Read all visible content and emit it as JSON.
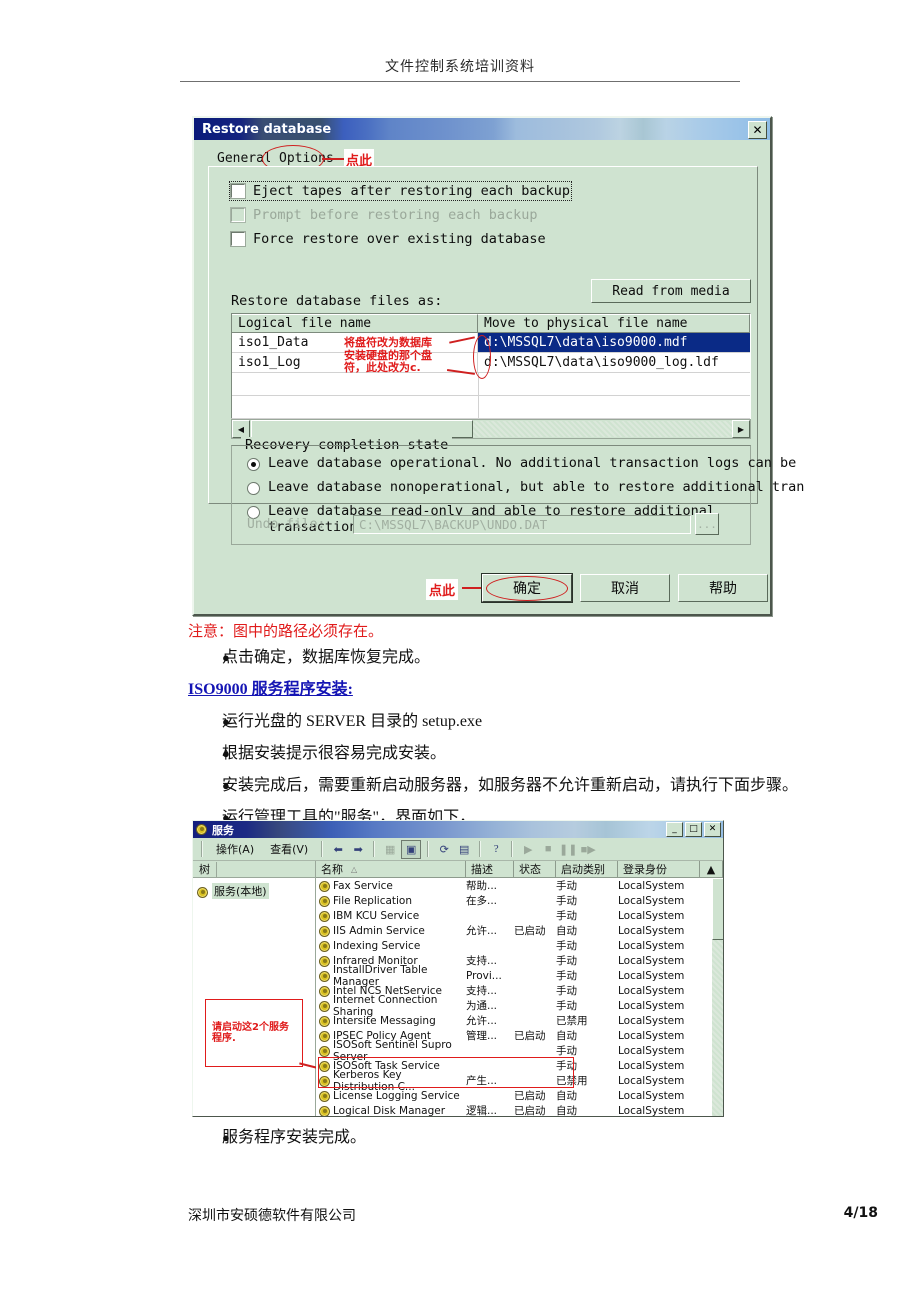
{
  "document": {
    "header_title": "文件控制系统培训资料",
    "footer_company": "深圳市安硕德软件有限公司",
    "footer_page": "4/18"
  },
  "restore_dialog": {
    "title": "Restore database",
    "close_glyph": "✕",
    "tabs": [
      {
        "label": "General"
      },
      {
        "label": "Options"
      }
    ],
    "checkboxes": [
      {
        "label": "Eject tapes after restoring each backup",
        "checked": false,
        "disabled": false,
        "focused": true
      },
      {
        "label": "Prompt before restoring each backup",
        "checked": false,
        "disabled": true,
        "focused": false
      },
      {
        "label": "Force restore over existing database",
        "checked": false,
        "disabled": false,
        "focused": false
      }
    ],
    "restore_files_label": "Restore database files as:",
    "read_from_media_label": "Read from media",
    "grid": {
      "columns": [
        "Logical file name",
        "Move to physical file name"
      ],
      "rows": [
        {
          "logical": "iso1_Data",
          "physical": "d:\\MSSQL7\\data\\iso9000.mdf",
          "selected": true
        },
        {
          "logical": "iso1_Log",
          "physical": "d:\\MSSQL7\\data\\iso9000_log.ldf",
          "selected": false
        }
      ]
    },
    "recovery_group_label": "Recovery completion state",
    "recovery_options": [
      {
        "label": "Leave database operational. No additional transaction logs can be",
        "selected": true
      },
      {
        "label": "Leave database nonoperational, but able to restore additional tran",
        "selected": false
      },
      {
        "label": "Leave database read-only and able to restore additional",
        "label2": "transaction logs.",
        "selected": false
      }
    ],
    "undo_file_label": "Undo file:",
    "undo_file_value": "C:\\MSSQL7\\BACKUP\\UNDO.DAT",
    "undo_browse_label": "...",
    "buttons": [
      {
        "label": "确定",
        "name": "ok"
      },
      {
        "label": "取消",
        "name": "cancel"
      },
      {
        "label": "帮助",
        "name": "help"
      }
    ],
    "annotations": {
      "click_here_tab": "点此",
      "click_here_ok": "点此",
      "drive_note_line1": "将盘符改为数据库",
      "drive_note_line2": "安装硬盘的那个盘",
      "drive_note_line3": "符，此处改为c."
    }
  },
  "body_text": {
    "note": "注意：图中的路径必须存在。",
    "bullets_before": [
      "点击确定，数据库恢复完成。"
    ],
    "section_heading": "ISO9000 服务程序安装:",
    "bullets_after": [
      "运行光盘的 SERVER 目录的 setup.exe",
      "根据安装提示很容易完成安装。",
      "安装完成后，需要重新启动服务器，如服务器不允许重新启动，请执行下面步骤。",
      "运行管理工具的\"服务\"，界面如下，"
    ],
    "bullet_last": "服务程序安装完成。",
    "bullet_glyph": "●"
  },
  "services_window": {
    "title": "服务",
    "window_buttons": [
      "_",
      "□",
      "✕"
    ],
    "menus": [
      "操作(A)",
      "查看(V)"
    ],
    "toolbar_icons": [
      "back-arrow",
      "forward-arrow",
      "up-folder",
      "show-tree",
      "refresh",
      "export-list",
      "help",
      "start",
      "stop",
      "pause",
      "resume"
    ],
    "tree_tab_label": "树",
    "tree_root": "服务(本地)",
    "annotation_box": {
      "line1": "请启动这2个服务",
      "line2": "程序."
    },
    "columns": [
      "名称",
      "描述",
      "状态",
      "启动类别",
      "登录身份"
    ],
    "sort_glyph": "△",
    "rows": [
      {
        "name": "Fax Service",
        "desc": "帮助...",
        "state": "",
        "startup": "手动",
        "logon": "LocalSystem",
        "highlight": false
      },
      {
        "name": "File Replication",
        "desc": "在多...",
        "state": "",
        "startup": "手动",
        "logon": "LocalSystem",
        "highlight": false
      },
      {
        "name": "IBM KCU Service",
        "desc": "",
        "state": "",
        "startup": "手动",
        "logon": "LocalSystem",
        "highlight": false
      },
      {
        "name": "IIS Admin Service",
        "desc": "允许...",
        "state": "已启动",
        "startup": "自动",
        "logon": "LocalSystem",
        "highlight": false
      },
      {
        "name": "Indexing Service",
        "desc": "",
        "state": "",
        "startup": "手动",
        "logon": "LocalSystem",
        "highlight": false
      },
      {
        "name": "Infrared Monitor",
        "desc": "支持...",
        "state": "",
        "startup": "手动",
        "logon": "LocalSystem",
        "highlight": false
      },
      {
        "name": "InstallDriver Table Manager",
        "desc": "Provi...",
        "state": "",
        "startup": "手动",
        "logon": "LocalSystem",
        "highlight": false
      },
      {
        "name": "Intel NCS NetService",
        "desc": "支持...",
        "state": "",
        "startup": "手动",
        "logon": "LocalSystem",
        "highlight": false
      },
      {
        "name": "Internet Connection Sharing",
        "desc": "为通...",
        "state": "",
        "startup": "手动",
        "logon": "LocalSystem",
        "highlight": false
      },
      {
        "name": "Intersite Messaging",
        "desc": "允许...",
        "state": "",
        "startup": "已禁用",
        "logon": "LocalSystem",
        "highlight": false
      },
      {
        "name": "IPSEC Policy Agent",
        "desc": "管理...",
        "state": "已启动",
        "startup": "自动",
        "logon": "LocalSystem",
        "highlight": false
      },
      {
        "name": "ISOSoft Sentinel Supro Server",
        "desc": "",
        "state": "",
        "startup": "手动",
        "logon": "LocalSystem",
        "highlight": true
      },
      {
        "name": "ISOSoft Task Service",
        "desc": "",
        "state": "",
        "startup": "手动",
        "logon": "LocalSystem",
        "highlight": true
      },
      {
        "name": "Kerberos Key Distribution C...",
        "desc": "产生...",
        "state": "",
        "startup": "已禁用",
        "logon": "LocalSystem",
        "highlight": false
      },
      {
        "name": "License Logging Service",
        "desc": "",
        "state": "已启动",
        "startup": "自动",
        "logon": "LocalSystem",
        "highlight": false
      },
      {
        "name": "Logical Disk Manager",
        "desc": "逻辑...",
        "state": "已启动",
        "startup": "自动",
        "logon": "LocalSystem",
        "highlight": false
      }
    ]
  },
  "colors": {
    "dialog_face": "#cfe3d0",
    "titlebar_blue": "#0a1a7a",
    "selection_blue": "#0a2a86",
    "annotation_red": "#e01b1b",
    "link_blue": "#1414b4"
  }
}
